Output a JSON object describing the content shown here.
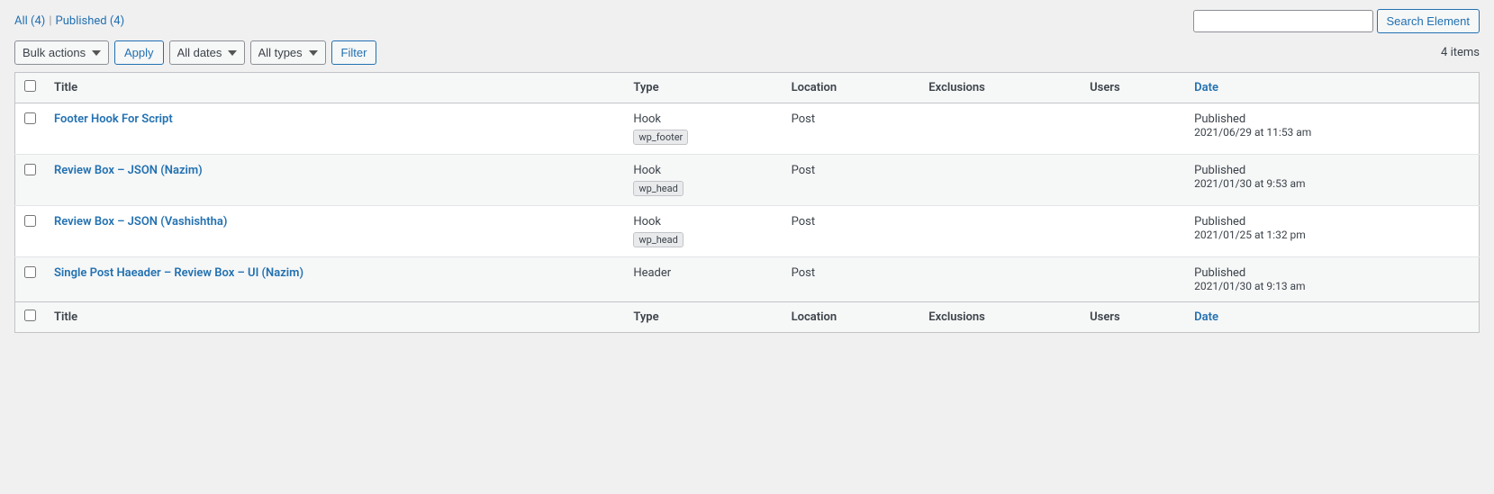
{
  "filter_links": {
    "all_label": "All",
    "all_count": "(4)",
    "sep": "|",
    "published_label": "Published",
    "published_count": "(4)"
  },
  "search": {
    "placeholder": "",
    "button_label": "Search Element"
  },
  "toolbar": {
    "bulk_actions_label": "Bulk actions",
    "apply_label": "Apply",
    "all_dates_label": "All dates",
    "all_types_label": "All types",
    "filter_label": "Filter",
    "items_count": "4 items"
  },
  "table": {
    "columns": {
      "title": "Title",
      "type": "Type",
      "location": "Location",
      "exclusions": "Exclusions",
      "users": "Users",
      "date": "Date"
    },
    "rows": [
      {
        "id": 1,
        "title": "Footer Hook For Script",
        "type": "Hook",
        "hook_tag": "wp_footer",
        "location": "Post",
        "exclusions": "",
        "users": "",
        "date_status": "Published",
        "date_value": "2021/06/29 at 11:53 am"
      },
      {
        "id": 2,
        "title": "Review Box – JSON (Nazim)",
        "type": "Hook",
        "hook_tag": "wp_head",
        "location": "Post",
        "exclusions": "",
        "users": "",
        "date_status": "Published",
        "date_value": "2021/01/30 at 9:53 am"
      },
      {
        "id": 3,
        "title": "Review Box – JSON (Vashishtha)",
        "type": "Hook",
        "hook_tag": "wp_head",
        "location": "Post",
        "exclusions": "",
        "users": "",
        "date_status": "Published",
        "date_value": "2021/01/25 at 1:32 pm"
      },
      {
        "id": 4,
        "title": "Single Post Haeader – Review Box – UI (Nazim)",
        "type": "Header",
        "hook_tag": "",
        "location": "Post",
        "exclusions": "",
        "users": "",
        "date_status": "Published",
        "date_value": "2021/01/30 at 9:13 am"
      }
    ]
  }
}
